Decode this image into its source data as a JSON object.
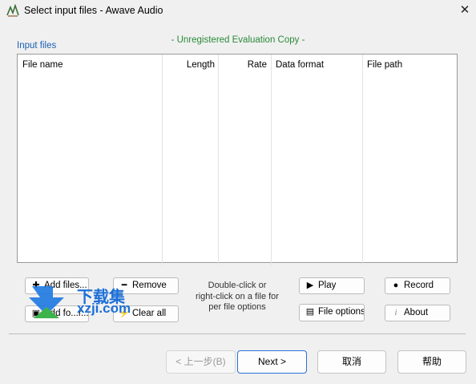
{
  "window": {
    "title": "Select input files - Awave Audio",
    "app_icon": "awave-audio-icon",
    "close_icon": "close-icon"
  },
  "eval_notice": "- Unregistered Evaluation Copy -",
  "group_label": "Input files",
  "columns": [
    "File name",
    "Length",
    "Rate",
    "Data format",
    "File path"
  ],
  "rows": [],
  "buttons": {
    "add_files": "Add files...",
    "add_folder": "Add fo...r...",
    "remove": "Remove",
    "clear_all": "Clear all",
    "play": "Play",
    "file_options": "File options",
    "record": "Record",
    "about": "About"
  },
  "hint_lines": [
    "Double-click or",
    "right-click on a file for",
    "per file options"
  ],
  "footer": {
    "back": "< 上一步(B)",
    "next": "Next >",
    "cancel": "取消",
    "help": "帮助"
  },
  "watermark": {
    "line1": "下载集",
    "line2": "xzji.com"
  },
  "colors": {
    "eval_text": "#2a8a3a",
    "group_label": "#1a5fb4",
    "watermark": "#1c6fd8"
  }
}
